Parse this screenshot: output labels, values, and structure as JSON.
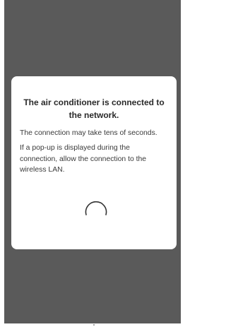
{
  "dialog": {
    "title": "The air conditioner is connected to the network.",
    "subtitle": "The connection may take tens of seconds.",
    "body": "If a pop-up is displayed during the connection, allow the connection to the wireless LAN."
  },
  "colors": {
    "overlay": "#5a5a5a",
    "dialog_background": "#ffffff",
    "text": "#3a3a3a",
    "spinner": "#333333"
  },
  "icons": {
    "loading": "loading-spinner-icon"
  }
}
